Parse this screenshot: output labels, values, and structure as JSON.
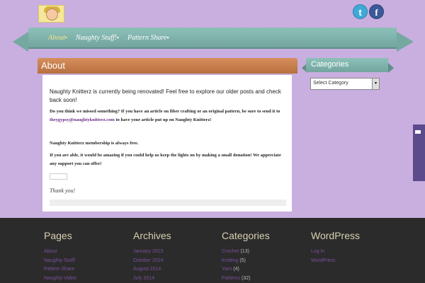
{
  "header": {
    "social": {
      "twitter": "t",
      "facebook": "f"
    }
  },
  "nav": {
    "items": [
      {
        "label": "About"
      },
      {
        "label": "Naughty Stuff!"
      },
      {
        "label": "Pattern Share"
      }
    ],
    "caret": "▾"
  },
  "about": {
    "title": "About",
    "intro": "Naughty Knitterz is currently being renovated! Feel free to explore our older posts and check back soon!",
    "article_prompt": "Do you think we missed something? If you have an article on fiber crafting or an original pattern, be sure to send it to",
    "email": "theygypsy@naughtyknitterz.com",
    "article_suffix": " to have your article put up on Naughty Knitterz!",
    "membership": "Naughty Knitterz membership is always free.",
    "donation": "If you are able, it would be amazing if you could help us keep the lights on by making a small donation! We appreciate any support you can offer!",
    "thanks": "Thank you!"
  },
  "sidebar": {
    "title": "Categories",
    "select_value": "Select Category",
    "select_arrow": "▾"
  },
  "footer": {
    "pages": {
      "title": "Pages",
      "items": [
        "About",
        "Naughty Stuff!",
        "Pattern Share",
        "Naughty Video"
      ]
    },
    "archives": {
      "title": "Archives",
      "items": [
        "January 2015",
        "October 2014",
        "August 2014",
        "July 2014"
      ]
    },
    "categories": {
      "title": "Categories",
      "items": [
        {
          "label": "Crochet",
          "count": "(13)"
        },
        {
          "label": "Knitting",
          "count": "(5)"
        },
        {
          "label": "Yarn",
          "count": "(4)"
        },
        {
          "label": "Patterns",
          "count": "(32)"
        }
      ]
    },
    "wordpress": {
      "title": "WordPress",
      "items": [
        "Log in",
        "WordPress"
      ]
    }
  }
}
